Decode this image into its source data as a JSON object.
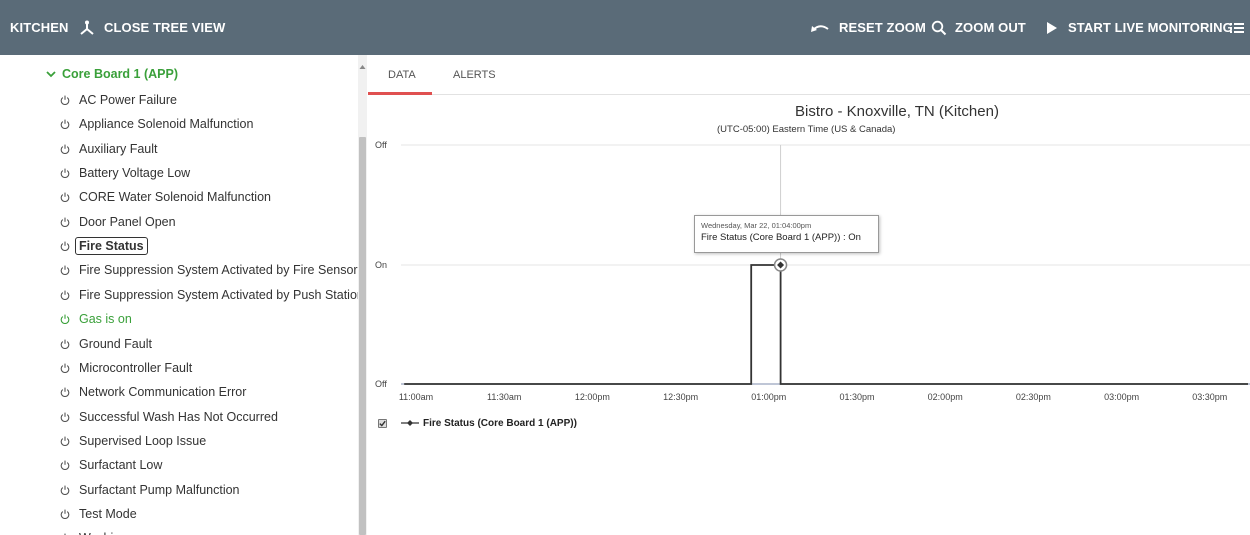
{
  "topbar": {
    "site": "KITCHEN",
    "close_tree": "CLOSE TREE VIEW",
    "reset_zoom": "RESET ZOOM",
    "zoom_out": "ZOOM OUT",
    "start_live": "START LIVE MONITORING",
    "menu_icon": "list-icon"
  },
  "sidebar": {
    "parent": "Core Board 1 (APP)",
    "items": [
      "AC Power Failure",
      "Appliance Solenoid Malfunction",
      "Auxiliary Fault",
      "Battery Voltage Low",
      "CORE Water Solenoid Malfunction",
      "Door Panel Open",
      "Fire Status",
      "Fire Suppression System Activated by Fire Sensor",
      "Fire Suppression System Activated by Push Station",
      "Gas is on",
      "Ground Fault",
      "Microcontroller Fault",
      "Network Communication Error",
      "Successful Wash Has Not Occurred",
      "Supervised Loop Issue",
      "Surfactant Low",
      "Surfactant Pump Malfunction",
      "Test Mode",
      "Washing"
    ],
    "selected": "Fire Status",
    "active_green": "Gas is on"
  },
  "tabs": {
    "data": "DATA",
    "alerts": "ALERTS",
    "active": "DATA"
  },
  "colors": {
    "topbar": "#5a6b78",
    "accent_green": "#3aa03a",
    "tab_underline": "#e05050",
    "series": "#333333"
  },
  "chart_data": {
    "type": "line",
    "title": "Bistro - Knoxville, TN (Kitchen)",
    "subtitle": "(UTC-05:00) Eastern Time (US & Canada)",
    "x_ticks": [
      "11:00am",
      "11:30am",
      "12:00pm",
      "12:30pm",
      "01:00pm",
      "01:30pm",
      "02:00pm",
      "02:30pm",
      "03:00pm",
      "03:30pm"
    ],
    "y_ticks": [
      "Off",
      "On",
      "Off"
    ],
    "series": [
      {
        "name": "Fire Status (Core Board 1 (APP))",
        "points": [
          [
            "10:56am",
            "Off"
          ],
          [
            "12:54pm",
            "Off"
          ],
          [
            "12:54pm",
            "On"
          ],
          [
            "01:04pm",
            "On"
          ],
          [
            "01:04pm",
            "Off"
          ],
          [
            "03:43pm",
            "Off"
          ]
        ]
      }
    ],
    "crosshair_x": "01:04pm",
    "tooltip": {
      "date": "Wednesday, Mar 22, 01:04:00pm",
      "text": "Fire Status (Core Board 1 (APP)) : On"
    },
    "legend": "Fire Status (Core Board 1 (APP))",
    "legend_checked": true
  }
}
